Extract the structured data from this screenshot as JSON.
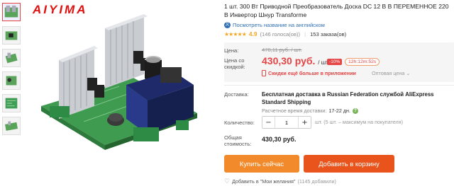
{
  "brand": "AIYIMA",
  "product": {
    "title": "1 шт. 300 Вт Приводной Преобразователь Доска DC 12 В В ПЕРЕМЕННОЕ 220 В Инвертор Шнур Transforme",
    "translate_link": "Посмотреть название на английском",
    "rating_score": "4.9",
    "votes": "(146 голоса(ов))",
    "orders": "153 заказа(ов)"
  },
  "price": {
    "price_label": "Цена:",
    "old_price": "478,11 руб. / шт.",
    "discount_label": "Цена со скидкой:",
    "new_price": "430,30 руб.",
    "unit": "/ шт.",
    "discount": "-10%",
    "timer": "12h:12m:52s",
    "app_deal": "Скидки ещё больше в приложении",
    "wholesale": "Оптовая цена"
  },
  "shipping": {
    "label": "Доставка:",
    "text": "Бесплатная доставка в Russian Federation службой AliExpress Standard Shipping",
    "time_label": "Расчетное время доставки:",
    "time_value": "17-22 дн."
  },
  "quantity": {
    "label": "Количество:",
    "value": "1",
    "note": "шт. (5 шт. – максимум на покупателя)"
  },
  "total": {
    "label": "Общая стоимость:",
    "value": "430,30 руб."
  },
  "actions": {
    "buy_now": "Купить сейчас",
    "add_to_cart": "Добавить в корзину",
    "wishlist": "Добавить в \"Мои желания\"",
    "wishlist_count": "(1145 добавили)"
  },
  "colors": {
    "accent_red": "#e64545",
    "buy_orange": "#f28a2b",
    "cart_orange": "#e8541c",
    "star": "#f5a623",
    "link_blue": "#2f6fb3"
  }
}
